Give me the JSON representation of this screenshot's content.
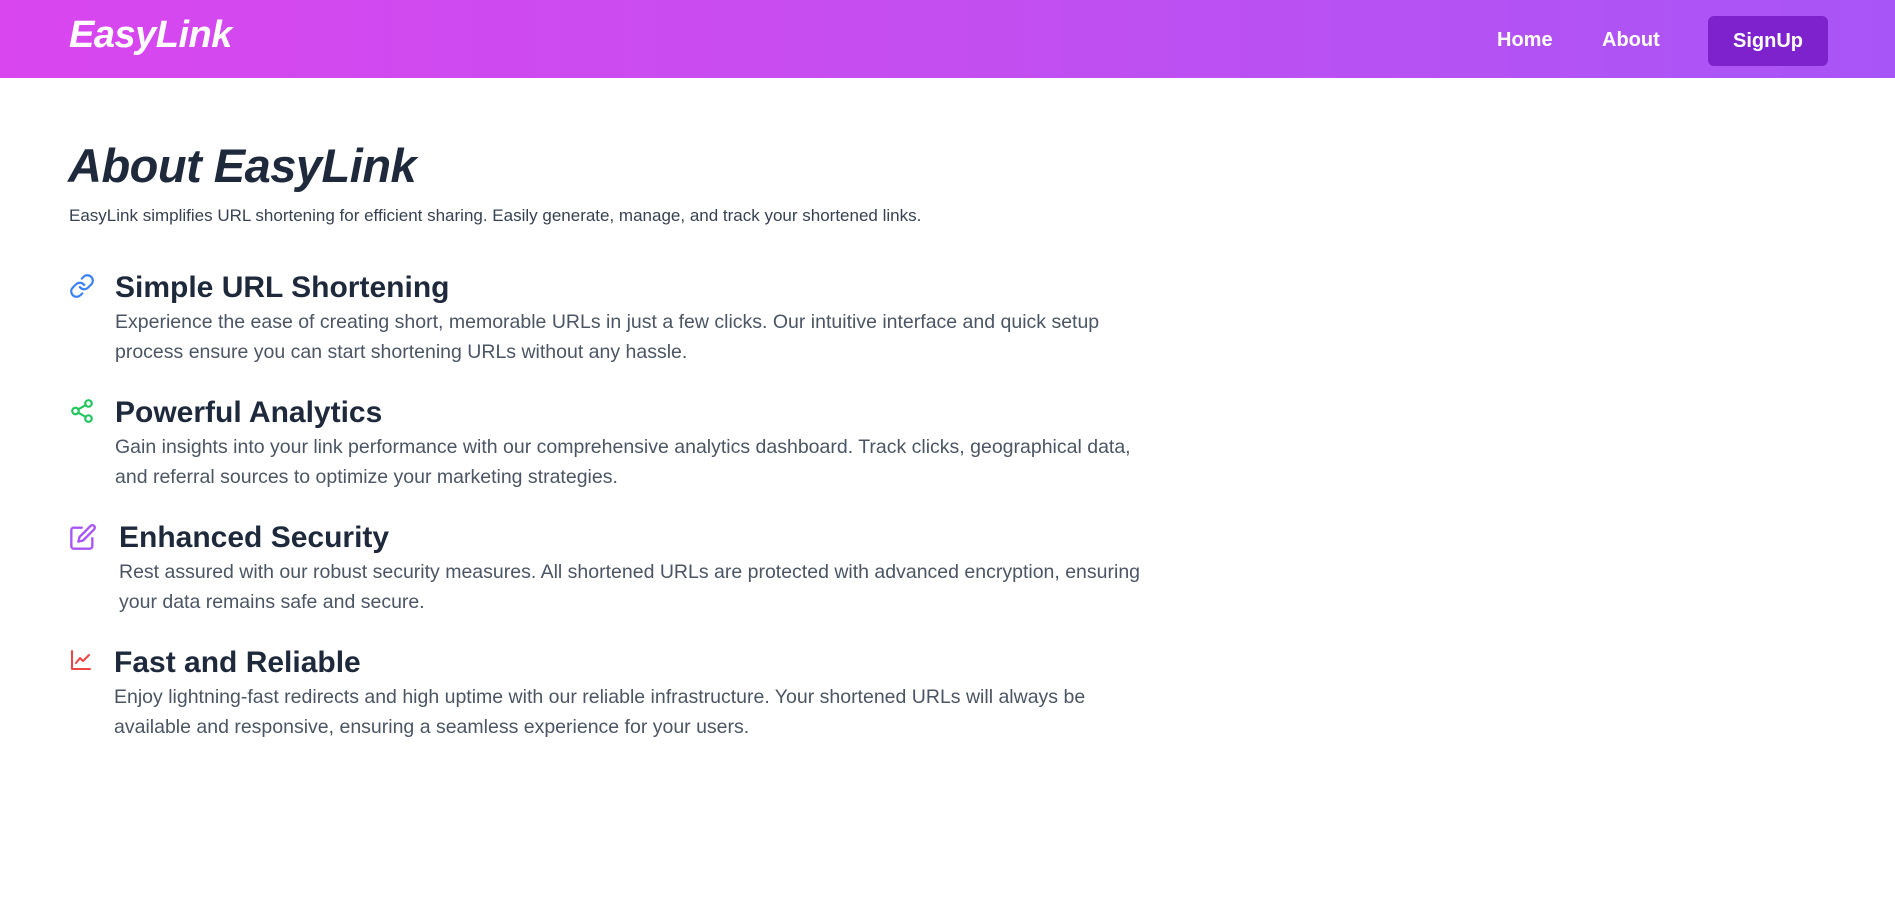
{
  "navbar": {
    "brand": "EasyLink",
    "links": [
      {
        "label": "Home"
      },
      {
        "label": "About"
      }
    ],
    "signup_label": "SignUp"
  },
  "page": {
    "title": "About EasyLink",
    "subtitle": "EasyLink simplifies URL shortening for efficient sharing. Easily generate, manage, and track your shortened links."
  },
  "features": [
    {
      "icon": "link-icon",
      "icon_color": "#3b82f6",
      "title": "Simple URL Shortening",
      "description": "Experience the ease of creating short, memorable URLs in just a few clicks. Our intuitive interface and quick setup process ensure you can start shortening URLs without any hassle."
    },
    {
      "icon": "share-icon",
      "icon_color": "#22c55e",
      "title": "Powerful Analytics",
      "description": "Gain insights into your link performance with our comprehensive analytics dashboard. Track clicks, geographical data, and referral sources to optimize your marketing strategies."
    },
    {
      "icon": "edit-icon",
      "icon_color": "#a855f7",
      "title": "Enhanced Security",
      "description": "Rest assured with our robust security measures. All shortened URLs are protected with advanced encryption, ensuring your data remains safe and secure."
    },
    {
      "icon": "chart-line-icon",
      "icon_color": "#ef4444",
      "title": "Fast and Reliable",
      "description": "Enjoy lightning-fast redirects and high uptime with our reliable infrastructure. Your shortened URLs will always be available and responsive, ensuring a seamless experience for your users."
    }
  ],
  "colors": {
    "navbar_gradient_start": "#d946ef",
    "navbar_gradient_end": "#a855f7",
    "signup_button": "#7e22ce",
    "heading": "#1e293b",
    "body_text": "#4b5563"
  }
}
